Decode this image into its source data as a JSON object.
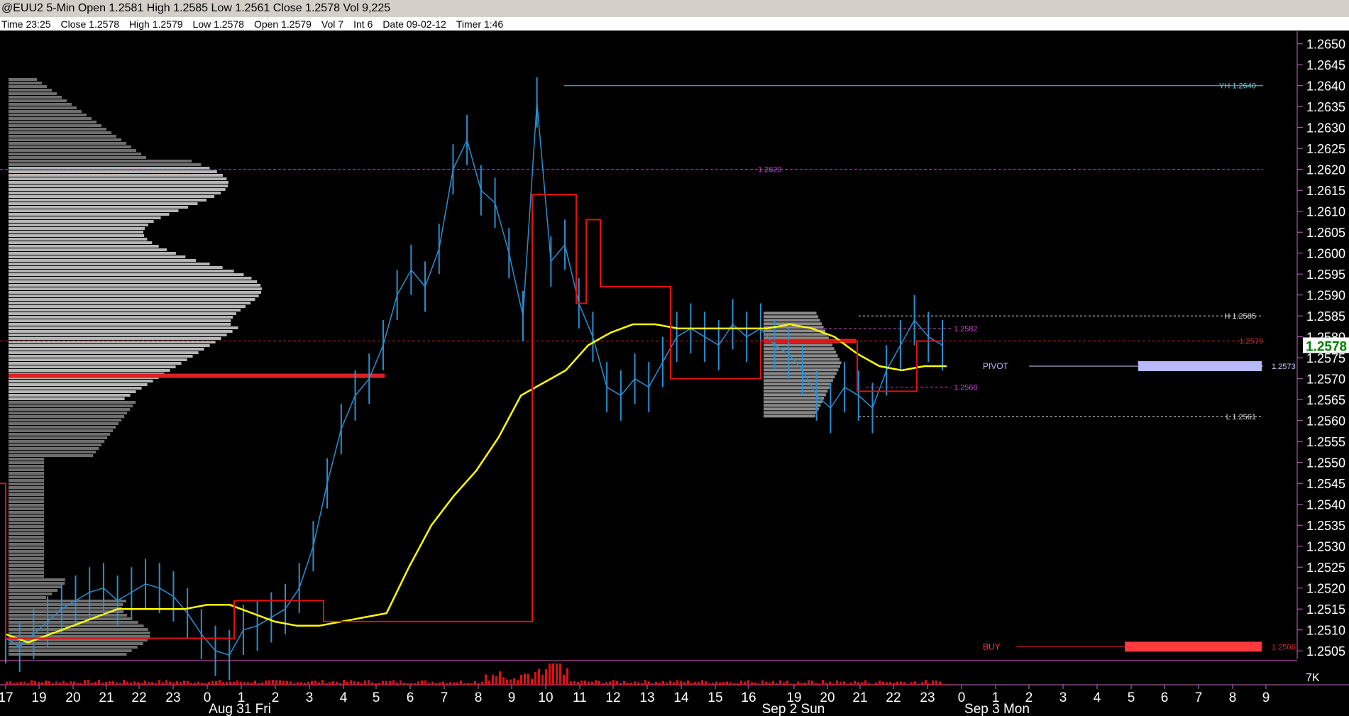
{
  "title_bar": {
    "text": "@EUU2 5-Min Open 1.2581 High 1.2585 Low 1.2561 Close 1.2578 Vol 9,225"
  },
  "info_bar": {
    "items": [
      "Time 23:25",
      "Close 1.2578",
      "High 1.2579",
      "Low 1.2578",
      "Open 1.2579",
      "Vol 7",
      "Int 6",
      "Date 09-02-12",
      "Timer 1:46"
    ]
  },
  "chart_data": {
    "type": "line",
    "symbol": "@EUU2",
    "interval": "5-Min",
    "y_axis": {
      "range": [
        1.2503,
        1.2653
      ],
      "ticks": [
        "1.2650",
        "1.2645",
        "1.2640",
        "1.2635",
        "1.2630",
        "1.2625",
        "1.2620",
        "1.2615",
        "1.2610",
        "1.2605",
        "1.2600",
        "1.2595",
        "1.2590",
        "1.2585",
        "1.2580",
        "1.2575",
        "1.2570",
        "1.2565",
        "1.2560",
        "1.2555",
        "1.2550",
        "1.2545",
        "1.2540",
        "1.2535",
        "1.2530",
        "1.2525",
        "1.2520",
        "1.2515",
        "1.2510",
        "1.2505"
      ],
      "last_price": "1.2578"
    },
    "x_axis": {
      "hour_labels": [
        "17",
        "19",
        "20",
        "21",
        "22",
        "23",
        "0",
        "1",
        "2",
        "3",
        "4",
        "5",
        "6",
        "7",
        "8",
        "9",
        "10",
        "11",
        "12",
        "13",
        "14",
        "15",
        "16",
        "19",
        "20",
        "21",
        "22",
        "23",
        "0",
        "1",
        "2",
        "3",
        "4",
        "5",
        "6",
        "7",
        "8",
        "9"
      ],
      "date_labels": [
        "Aug 31 Fri",
        "Sep 2 Sun",
        "Sep 3 Mon"
      ]
    },
    "volume_axis_label": "7K",
    "price_series": {
      "name": "price",
      "color": "#2a8fd0",
      "values": [
        1.2508,
        1.2506,
        1.2509,
        1.2512,
        1.2515,
        1.2517,
        1.2519,
        1.252,
        1.2517,
        1.2519,
        1.2521,
        1.252,
        1.2518,
        1.2514,
        1.2509,
        1.2505,
        1.2504,
        1.251,
        1.2511,
        1.2513,
        1.2515,
        1.252,
        1.253,
        1.2545,
        1.2558,
        1.2566,
        1.257,
        1.2578,
        1.259,
        1.2596,
        1.2592,
        1.2601,
        1.262,
        1.2627,
        1.2615,
        1.2612,
        1.26,
        1.2585,
        1.2636,
        1.2598,
        1.2602,
        1.2588,
        1.258,
        1.2568,
        1.2566,
        1.257,
        1.2568,
        1.2574,
        1.258,
        1.2582,
        1.258,
        1.2578,
        1.2583,
        1.258,
        1.2582,
        1.2578,
        1.2576,
        1.2572,
        1.2566,
        1.2563,
        1.2568,
        1.2566,
        1.2563,
        1.2572,
        1.2578,
        1.2584,
        1.258,
        1.2578
      ]
    },
    "vwap_series": {
      "name": "vwap",
      "color": "#ffff00",
      "values": [
        1.2509,
        1.2507,
        1.2509,
        1.2511,
        1.2513,
        1.2515,
        1.2515,
        1.2515,
        1.2515,
        1.2516,
        1.2516,
        1.2514,
        1.2512,
        1.2511,
        1.2511,
        1.2512,
        1.2513,
        1.2514,
        1.2525,
        1.2535,
        1.2542,
        1.2548,
        1.2556,
        1.2566,
        1.2569,
        1.2572,
        1.2578,
        1.2581,
        1.2583,
        1.2583,
        1.2582,
        1.2582,
        1.2582,
        1.2582,
        1.2582,
        1.2583,
        1.2582,
        1.258,
        1.2576,
        1.2573,
        1.2572,
        1.2573,
        1.2573
      ]
    },
    "levels": [
      {
        "label": "YH 1.2640",
        "value": 1.264,
        "color": "#66cccc"
      },
      {
        "label": "1.2620",
        "value": 1.262,
        "color": "#cc44cc"
      },
      {
        "label": "H 1.2585",
        "value": 1.2585,
        "color": "#dddddd"
      },
      {
        "label": "1.2582",
        "value": 1.2582,
        "color": "#cc44cc"
      },
      {
        "label": "1.2579",
        "value": 1.2579,
        "color": "#dd2222"
      },
      {
        "label": "1.2573",
        "value": 1.2573,
        "color": "#ccccff"
      },
      {
        "label": "1.2568",
        "value": 1.2568,
        "color": "#cc44cc"
      },
      {
        "label": "L 1.2561",
        "value": 1.2561,
        "color": "#dddddd"
      },
      {
        "label": "1.2506",
        "value": 1.2506,
        "color": "#dd2222"
      }
    ],
    "pivot": {
      "label": "PIVOT",
      "value": "1.2573",
      "color": "#b8b8ff"
    },
    "buy": {
      "label": "BUY",
      "value": "1.2506",
      "color": "#ff3b3b"
    },
    "grid": false,
    "legend": "none"
  }
}
